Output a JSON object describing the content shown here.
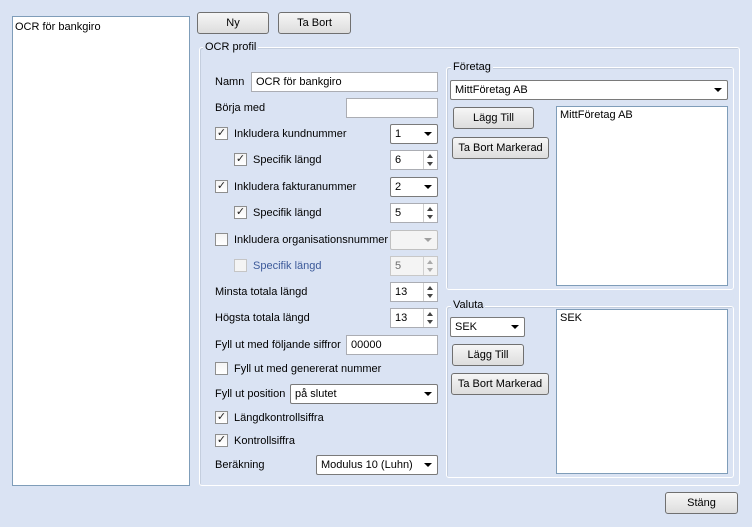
{
  "profile_list": {
    "items": [
      "OCR för bankgiro"
    ]
  },
  "toolbar": {
    "new_label": "Ny",
    "delete_label": "Ta Bort"
  },
  "ocr_group": {
    "title": "OCR profil",
    "name_label": "Namn",
    "name_value": "OCR för bankgiro",
    "start_label": "Börja med",
    "start_value": "",
    "include_customer_label": "Inkludera kundnummer",
    "include_customer_checked": true,
    "customer_position": "1",
    "customer_specific_label": "Specifik längd",
    "customer_specific_checked": true,
    "customer_length": "6",
    "include_invoice_label": "Inkludera fakturanummer",
    "include_invoice_checked": true,
    "invoice_position": "2",
    "invoice_specific_label": "Specifik längd",
    "invoice_specific_checked": true,
    "invoice_length": "5",
    "include_org_label": "Inkludera organisationsnummer",
    "include_org_checked": false,
    "org_position": "",
    "org_specific_label": "Specifik längd",
    "org_specific_checked": false,
    "org_length": "5",
    "min_total_label": "Minsta totala längd",
    "min_total_value": "13",
    "max_total_label": "Högsta totala längd",
    "max_total_value": "13",
    "fill_digits_label": "Fyll ut med följande siffror",
    "fill_digits_value": "00000",
    "fill_generated_label": "Fyll ut med genererat nummer",
    "fill_generated_checked": false,
    "fill_position_label": "Fyll ut position",
    "fill_position_value": "på slutet",
    "length_check_label": "Längdkontrollsiffra",
    "length_check_checked": true,
    "check_digit_label": "Kontrollsiffra",
    "check_digit_checked": true,
    "calculation_label": "Beräkning",
    "calculation_value": "Modulus 10 (Luhn)"
  },
  "company_group": {
    "title": "Företag",
    "selected": "MittFöretag AB",
    "add_label": "Lägg Till",
    "remove_label": "Ta Bort Markerad",
    "items": [
      "MittFöretag AB"
    ]
  },
  "currency_group": {
    "title": "Valuta",
    "selected": "SEK",
    "add_label": "Lägg Till",
    "remove_label": "Ta Bort Markerad",
    "items": [
      "SEK"
    ]
  },
  "footer": {
    "close_label": "Stäng"
  },
  "check_glyph": "✓"
}
